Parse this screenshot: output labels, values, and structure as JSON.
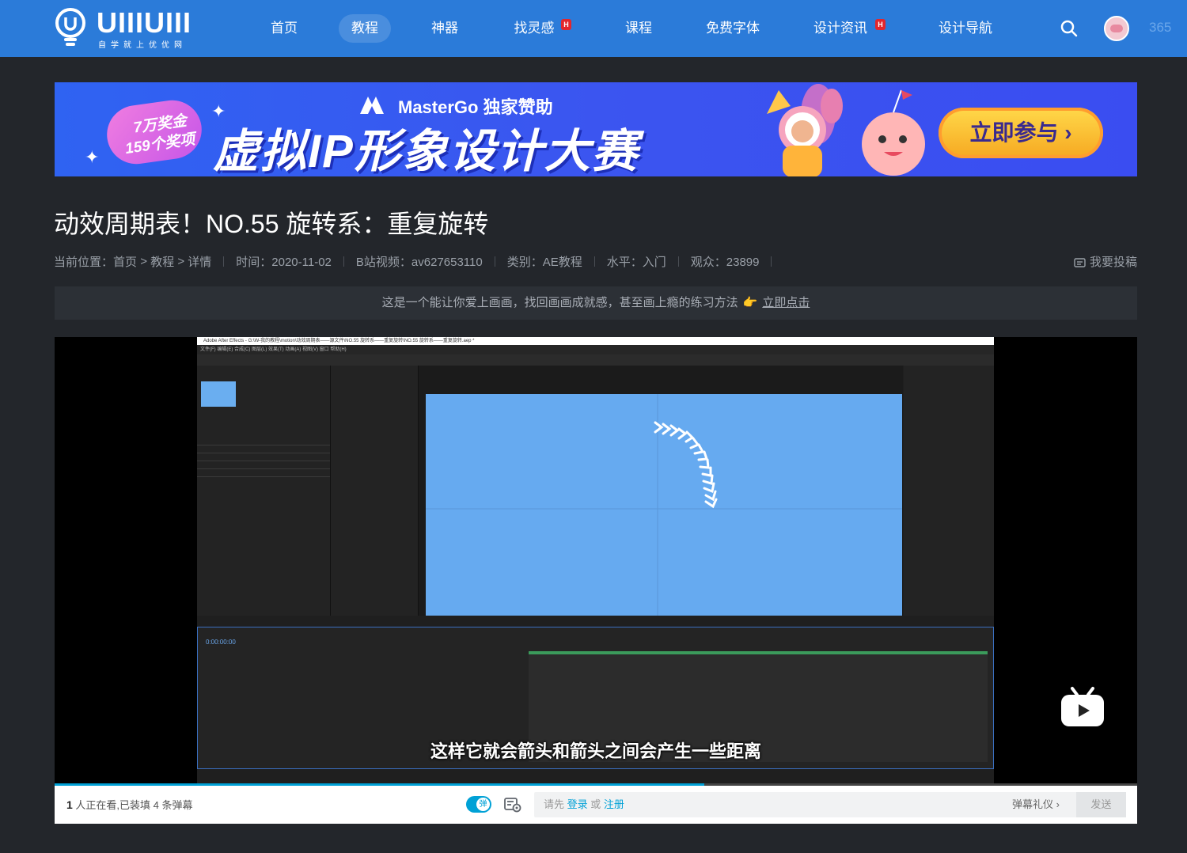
{
  "header": {
    "logo_text": "UIIIUIII",
    "logo_sub": "自学就上优优网",
    "nav": [
      {
        "label": "首页",
        "active": false,
        "hot": false
      },
      {
        "label": "教程",
        "active": true,
        "hot": false
      },
      {
        "label": "神器",
        "active": false,
        "hot": false
      },
      {
        "label": "找灵感",
        "active": false,
        "hot": true
      },
      {
        "label": "课程",
        "active": false,
        "hot": false
      },
      {
        "label": "免费字体",
        "active": false,
        "hot": false
      },
      {
        "label": "设计资讯",
        "active": false,
        "hot": true
      },
      {
        "label": "设计导航",
        "active": false,
        "hot": false
      }
    ],
    "hot_badge": "H",
    "score": "365",
    "search_icon": "search-icon",
    "bg_color": "#2b7bd9"
  },
  "banner": {
    "bubble_line1": "7万奖金",
    "bubble_line2": "159个奖项",
    "sponsor": "MasterGo 独家赞助",
    "title": "虚拟IP形象设计大赛",
    "button": "立即参与 ›"
  },
  "article": {
    "title": "动效周期表！NO.55 旋转系：重复旋转",
    "breadcrumb_label": "当前位置：",
    "breadcrumb": [
      "首页",
      "教程",
      "详情"
    ],
    "breadcrumb_sep": " > ",
    "time": "时间：2020-11-02",
    "bilibili": "B站视频：av627653110",
    "category": "类别：AE教程",
    "level": "水平：入门",
    "views": "观众：23899",
    "submit": "我要投稿"
  },
  "promo": {
    "text": "这是一个能让你爱上画画，找回画画成就感，甚至画上瘾的练习方法",
    "link": "立即点击"
  },
  "video": {
    "subtitle": "这样它就会箭头和箭头之间会产生一些距离",
    "ae_title": "Adobe After Effects - G:\\W-我的教程\\motion\\动效周期表——源文件\\NO.55 旋转系——重复旋转\\NO.55 旋转系——重复旋转.aep *",
    "ae_menu": "文件(F)   编辑(E)   合成(C)   图层(L)   效果(T)   动画(A)   视图(V)   窗口   帮助(H)",
    "timecode": "0:00:00:00",
    "progress": 0.6
  },
  "danmaku": {
    "viewers_count": "1",
    "viewers_text": " 人正在看,已装填 4 条弹幕",
    "toggle_label": "弹",
    "prompt_prefix": "请先",
    "login": "登录",
    "or": "或",
    "register": "注册",
    "gift": "弹幕礼仪 ›",
    "send": "发送"
  }
}
